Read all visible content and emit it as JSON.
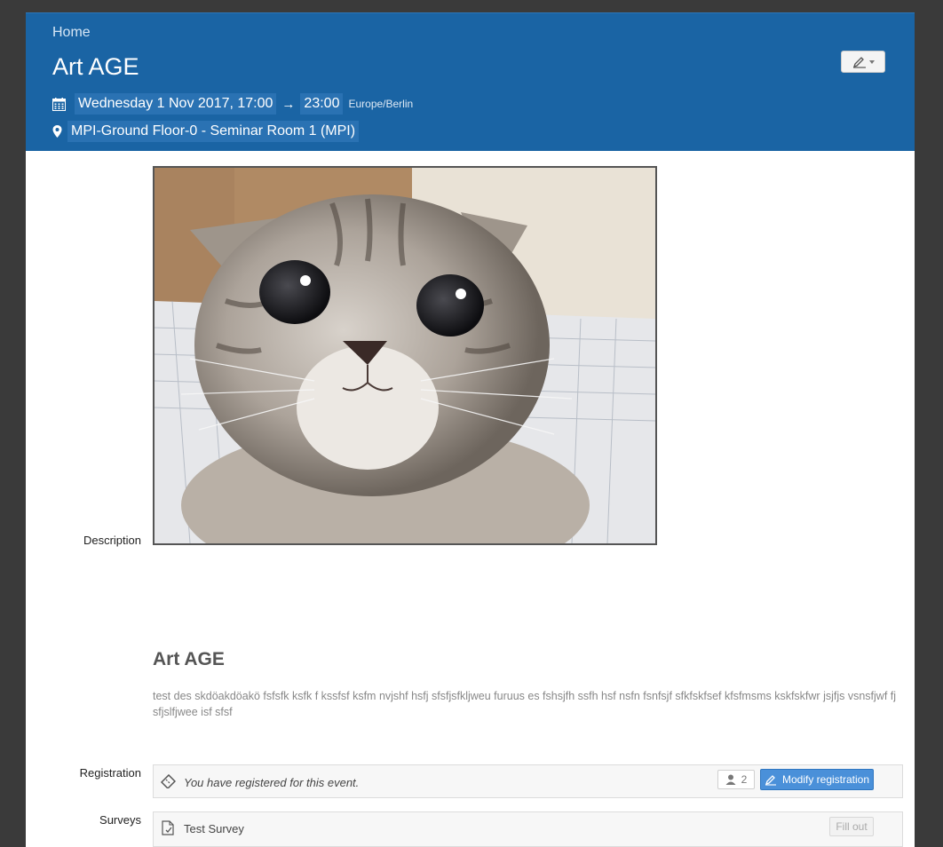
{
  "header": {
    "breadcrumb": "Home",
    "title": "Art AGE",
    "date_start": "Wednesday 1 Nov 2017, 17:00",
    "arrow": "→",
    "date_end": "23:00",
    "timezone": "Europe/Berlin",
    "location": "MPI-Ground Floor-0 - Seminar Room 1 (MPI)",
    "edit_icon": "pencil-icon",
    "calendar_icon": "calendar-icon",
    "location_icon": "map-pin-icon",
    "background_color": "#1a64a4"
  },
  "labels": {
    "description": "Description",
    "registration": "Registration",
    "surveys": "Surveys"
  },
  "description": {
    "heading": "Art AGE",
    "text": "test des skdöakdöakö fsfsfk ksfk f kssfsf ksfm nvjshf hsfj sfsfjsfkljweu furuus es fshsjfh ssfh hsf nsfn fsnfsjf sfkfskfsef kfsfmsms kskfskfwr jsjfjs vsnsfjwf fj sfjslfjwee isf sfsf"
  },
  "registration": {
    "message": "You have registered for this event.",
    "count": "2",
    "modify_label": "Modify registration",
    "ticket_icon": "ticket-icon",
    "user_icon": "user-icon"
  },
  "surveys": {
    "name": "Test Survey",
    "fill_label": "Fill out",
    "survey_icon": "survey-icon"
  }
}
